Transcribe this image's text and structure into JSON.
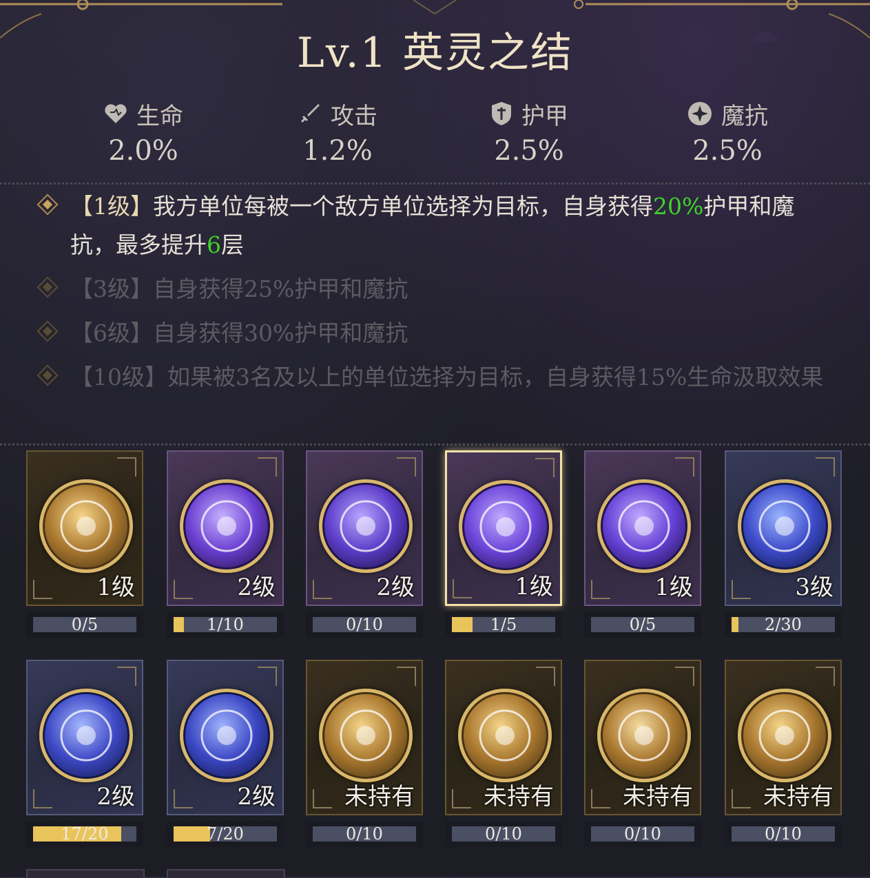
{
  "title": "Lv.1 英灵之结",
  "stats": [
    {
      "icon": "heart-icon",
      "label": "生命",
      "value": "2.0%"
    },
    {
      "icon": "sword-icon",
      "label": "攻击",
      "value": "1.2%"
    },
    {
      "icon": "shield-icon",
      "label": "护甲",
      "value": "2.5%"
    },
    {
      "icon": "magic-resist-icon",
      "label": "魔抗",
      "value": "2.5%"
    }
  ],
  "effects": [
    {
      "level": "【1级】",
      "active": true,
      "text_a": "我方单位每被一个敌方单位选择为目标，自身获得",
      "green_a": "20%",
      "text_b": "护甲和魔抗，最多提升",
      "green_b": "6",
      "text_c": "层"
    },
    {
      "level": "【3级】",
      "active": false,
      "text": "自身获得25%护甲和魔抗"
    },
    {
      "level": "【6级】",
      "active": false,
      "text": "自身获得30%护甲和魔抗"
    },
    {
      "level": "【10级】",
      "active": false,
      "text": "如果被3名及以上的单位选择为目标，自身获得15%生命汲取效果"
    }
  ],
  "cards": [
    {
      "theme": "gold",
      "emblem": "lotus-mandala-icon",
      "level": "1级",
      "progress": "0/5",
      "fill": 0.0,
      "selected": false,
      "colors": [
        "#f6d58a",
        "#a8772e",
        "#4a3416"
      ]
    },
    {
      "theme": "purple",
      "emblem": "vortex-icon",
      "level": "2级",
      "progress": "1/10",
      "fill": 0.1,
      "selected": false,
      "colors": [
        "#c6b0ff",
        "#6a3fd0",
        "#24134a"
      ]
    },
    {
      "theme": "purple",
      "emblem": "caduceus-icon",
      "level": "2级",
      "progress": "0/10",
      "fill": 0.0,
      "selected": false,
      "colors": [
        "#b8a6ff",
        "#5c3cc8",
        "#1e1448"
      ]
    },
    {
      "theme": "purple",
      "emblem": "valknut-icon",
      "level": "1级",
      "progress": "1/5",
      "fill": 0.2,
      "selected": true,
      "colors": [
        "#bfa8ff",
        "#6a44d8",
        "#221550"
      ]
    },
    {
      "theme": "purple",
      "emblem": "crescent-moon-icon",
      "level": "1级",
      "progress": "0/5",
      "fill": 0.0,
      "selected": false,
      "colors": [
        "#c0a8ff",
        "#6440d4",
        "#20144c"
      ]
    },
    {
      "theme": "blue",
      "emblem": "laurel-moon-icon",
      "level": "3级",
      "progress": "2/30",
      "fill": 0.067,
      "selected": false,
      "colors": [
        "#9ab4ff",
        "#3c4ac8",
        "#121a4c"
      ]
    },
    {
      "theme": "blue",
      "emblem": "triquetra-icon",
      "level": "2级",
      "progress": "17/20",
      "fill": 0.85,
      "selected": false,
      "colors": [
        "#a6b8ff",
        "#3d48c4",
        "#131a4a"
      ]
    },
    {
      "theme": "blue",
      "emblem": "chinese-knot-icon",
      "level": "2级",
      "progress": "7/20",
      "fill": 0.35,
      "selected": false,
      "colors": [
        "#9fb2ff",
        "#3a46c2",
        "#121848"
      ]
    },
    {
      "theme": "gold",
      "emblem": "labyrinth-icon",
      "level": "未持有",
      "progress": "0/10",
      "fill": 0.0,
      "selected": false,
      "colors": [
        "#f4d488",
        "#a8772e",
        "#463214"
      ]
    },
    {
      "theme": "gold",
      "emblem": "eye-of-horus-icon",
      "level": "未持有",
      "progress": "0/10",
      "fill": 0.0,
      "selected": false,
      "colors": [
        "#f4d488",
        "#a8772e",
        "#463214"
      ]
    },
    {
      "theme": "gold",
      "emblem": "lotus-icon",
      "level": "未持有",
      "progress": "0/10",
      "fill": 0.0,
      "selected": false,
      "colors": [
        "#f6dca0",
        "#a8772e",
        "#463214"
      ]
    },
    {
      "theme": "gold",
      "emblem": "triangle-circle-icon",
      "level": "未持有",
      "progress": "0/10",
      "fill": 0.0,
      "selected": false,
      "colors": [
        "#f4d488",
        "#a8772e",
        "#463214"
      ]
    }
  ]
}
